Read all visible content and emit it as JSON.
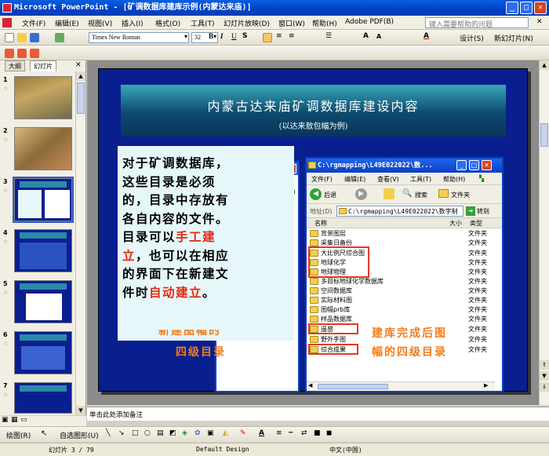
{
  "window": {
    "title": "Microsoft PowerPoint - [矿调数据库建库示例(内蒙达来庙)]"
  },
  "menu": {
    "items": [
      "文件(F)",
      "编辑(E)",
      "视图(V)",
      "插入(I)",
      "格式(O)",
      "工具(T)",
      "幻灯片放映(D)",
      "窗口(W)",
      "帮助(H)",
      "Adobe PDF(B)"
    ],
    "help_placeholder": "键入需要帮助的问题"
  },
  "format_toolbar": {
    "font": "Times New Roman",
    "size": "32",
    "design_label": "设计(S)",
    "new_slide_label": "新幻灯片(N)"
  },
  "left_pane": {
    "tab_outline": "大纲",
    "tab_slides": "幻灯片",
    "thumbnails": [
      "1",
      "2",
      "3",
      "4",
      "5",
      "6",
      "7"
    ]
  },
  "slide": {
    "title": "内蒙古达来庙矿调数据库建设内容",
    "subtitle": "(以达来敖包幅为例)",
    "body_lines": [
      {
        "parts": [
          {
            "t": "对于矿调数据库，",
            "red": false
          }
        ]
      },
      {
        "parts": [
          {
            "t": "这些目录是必须",
            "red": false
          }
        ]
      },
      {
        "parts": [
          {
            "t": "的，目录中存放有",
            "red": false
          }
        ]
      },
      {
        "parts": [
          {
            "t": "各自内容的文件。",
            "red": false
          }
        ]
      },
      {
        "parts": [
          {
            "t": "目录可以",
            "red": false
          },
          {
            "t": "手工建",
            "red": true
          }
        ]
      },
      {
        "parts": [
          {
            "t": "立",
            "red": true
          },
          {
            "t": "，也可以在相应",
            "red": false
          }
        ]
      },
      {
        "parts": [
          {
            "t": "的界面下在新建文",
            "red": false
          }
        ]
      },
      {
        "parts": [
          {
            "t": "件时",
            "red": false
          },
          {
            "t": "自动建立",
            "red": true
          },
          {
            "t": "。",
            "red": false
          }
        ]
      }
    ],
    "caption_left_1": "新建图幅的",
    "caption_left_2": "四级目录",
    "caption_right_1": "建库完成后图",
    "caption_right_2": "幅的四级目录"
  },
  "explorer": {
    "title": "C:\\rgmapping\\L49E022022\\数...",
    "menu": [
      "文件(F)",
      "编辑(E)",
      "查看(V)",
      "工具(T)",
      "帮助(H)"
    ],
    "back_label": "后退",
    "search_label": "搜索",
    "folders_label": "文件夹",
    "address_label": "地址(D)",
    "address_value": "C:\\rgmapping\\L49E022022\\数字制",
    "go_label": "转到",
    "col_name": "名称",
    "col_size": "大小",
    "col_type": "类型",
    "files": [
      {
        "name": "背景图层",
        "type": "文件夹"
      },
      {
        "name": "采集日备份",
        "type": "文件夹"
      },
      {
        "name": "大比例尺综合图",
        "type": "文件夹"
      },
      {
        "name": "地球化学",
        "type": "文件夹"
      },
      {
        "name": "地球物理",
        "type": "文件夹"
      },
      {
        "name": "多目标地球化学数据库",
        "type": "文件夹"
      },
      {
        "name": "空间数据库",
        "type": "文件夹"
      },
      {
        "name": "实际材料图",
        "type": "文件夹"
      },
      {
        "name": "图幅prb库",
        "type": "文件夹"
      },
      {
        "name": "样品数据库",
        "type": "文件夹"
      },
      {
        "name": "遥感",
        "type": "文件夹"
      },
      {
        "name": "野外手图",
        "type": "文件夹"
      },
      {
        "name": "综合成果",
        "type": "文件夹"
      }
    ]
  },
  "notes": {
    "placeholder": "单击此处添加备注"
  },
  "drawing_toolbar": {
    "draw_label": "绘图(R)",
    "autoshape_label": "自选图形(U)"
  },
  "status": {
    "slide": "幻灯片 3 / 79",
    "design": "Default Design",
    "language": "中文(中国)"
  },
  "colors": {
    "slide_bg": "#0a1f8f",
    "accent_red": "#e8260f",
    "caption_orange": "#f27d1d"
  }
}
